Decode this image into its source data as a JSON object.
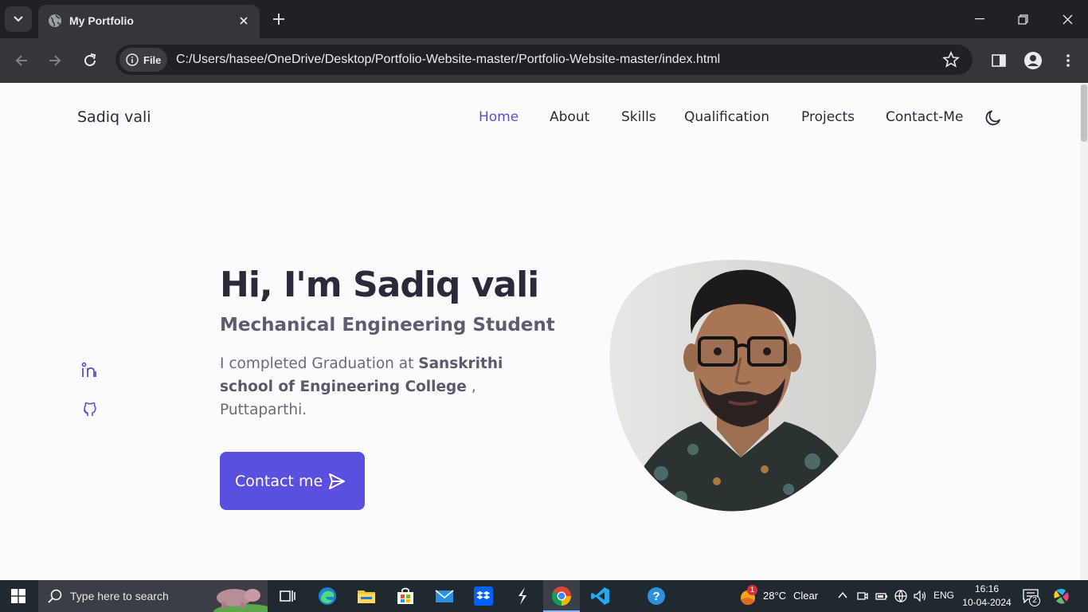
{
  "browser": {
    "tab_title": "My Portfolio",
    "site_chip_label": "File",
    "url": "C:/Users/hasee/OneDrive/Desktop/Portfolio-Website-master/Portfolio-Website-master/index.html"
  },
  "header": {
    "logo": "Sadiq vali",
    "nav": [
      {
        "label": "Home",
        "active": true
      },
      {
        "label": "About"
      },
      {
        "label": "Skills"
      },
      {
        "label": "Qualification"
      },
      {
        "label": "Projects"
      },
      {
        "label": "Contact-Me"
      }
    ],
    "theme_icon": "moon-icon"
  },
  "social": [
    "linkedin-icon",
    "github-icon"
  ],
  "hero": {
    "title": "Hi, I'm Sadiq vali",
    "subtitle": "Mechanical Engineering Student",
    "desc_prefix": "I completed Graduation at ",
    "desc_bold": "Sanskrithi school of Engineering College",
    "desc_suffix": " , Puttaparthi.",
    "button_label": "Contact me",
    "button_icon": "send-icon",
    "image": "profile-photo"
  },
  "colors": {
    "accent": "#5a4fdf",
    "nav_active": "#5a4fcf",
    "text": "#2a2a3a"
  },
  "taskbar": {
    "search_placeholder": "Type here to search",
    "weather_temp": "28°C",
    "weather_text": "Clear",
    "language": "ENG",
    "time": "16:16",
    "date": "10-04-2024",
    "notification_count": "2",
    "weather_badge": "1"
  }
}
